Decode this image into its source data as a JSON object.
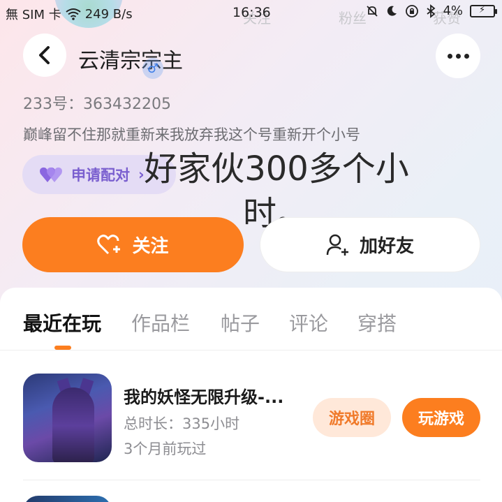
{
  "status_bar": {
    "carrier": "無 SIM 卡",
    "speed": "249 B/s",
    "time": "16:36",
    "battery": "4%"
  },
  "background_stats": {
    "following": "关注",
    "fans": "粉丝",
    "likes": "获赞"
  },
  "profile": {
    "username": "云清宗宗主",
    "uid": "233号：363432205",
    "bio": "巅峰留不住那就重新来我放弃我这个号重新开个小号",
    "match_label": "申请配对",
    "match_chevron": "›"
  },
  "overlay": {
    "text": "好家伙300多个小时。"
  },
  "actions": {
    "follow_label": "关注",
    "add_friend_label": "加好友"
  },
  "tabs": [
    {
      "label": "最近在玩"
    },
    {
      "label": "作品栏"
    },
    {
      "label": "帖子"
    },
    {
      "label": "评论"
    },
    {
      "label": "穿搭"
    }
  ],
  "games": [
    {
      "title": "我的妖怪无限升级-...",
      "total_time": "总时长：335小时",
      "last_played": "3个月前玩过",
      "circle_label": "游戏圈",
      "play_label": "玩游戏"
    }
  ],
  "colors": {
    "accent": "#fc7e1f",
    "match_purple": "#8a67e0"
  },
  "icons": {
    "back": "chevron-left-icon",
    "more": "more-dots-icon",
    "follow": "heart-plus-icon",
    "add_friend": "person-add-icon",
    "match": "double-heart-icon",
    "gender": "male-icon"
  }
}
